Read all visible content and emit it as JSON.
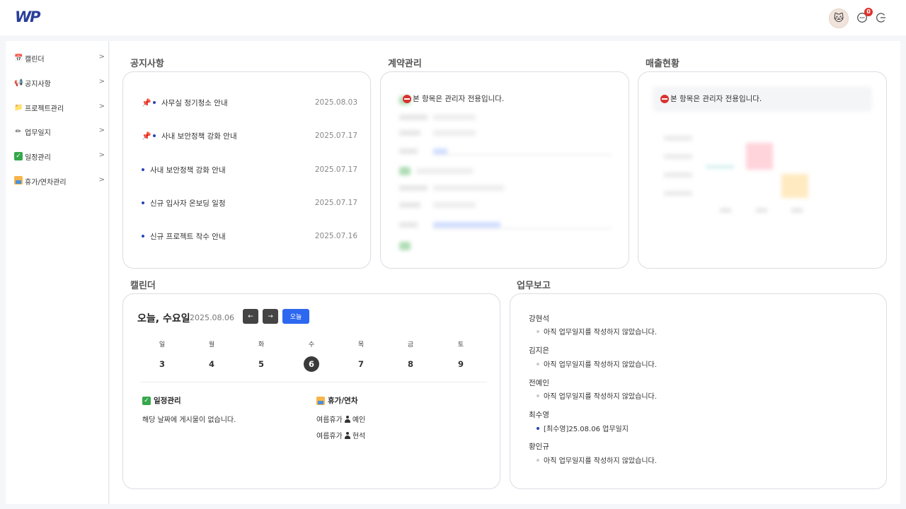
{
  "brand": {
    "logo": "WP"
  },
  "header": {
    "badge_count": "0"
  },
  "sidebar": {
    "items": [
      {
        "label": "캘린더",
        "icon": "calendar-icon"
      },
      {
        "label": "공지사항",
        "icon": "megaphone-icon"
      },
      {
        "label": "프로젝트관리",
        "icon": "folder-icon"
      },
      {
        "label": "업무일지",
        "icon": "pencil-icon"
      },
      {
        "label": "일정관리",
        "icon": "check-icon"
      },
      {
        "label": "휴가/연차관리",
        "icon": "vacation-icon"
      }
    ]
  },
  "notice": {
    "title": "공지사항",
    "items": [
      {
        "title": "사무실 정기청소 안내",
        "date": "2025.08.03",
        "pinned": true
      },
      {
        "title": "사내 보안정책 강화 안내",
        "date": "2025.07.17",
        "pinned": true
      },
      {
        "title": "사내 보안정책 강화 안내",
        "date": "2025.07.17",
        "pinned": false
      },
      {
        "title": "신규 입사자 온보딩 일정",
        "date": "2025.07.17",
        "pinned": false
      },
      {
        "title": "신규 프로젝트 착수 안내",
        "date": "2025.07.16",
        "pinned": false
      }
    ]
  },
  "contract": {
    "title": "계약관리",
    "admin_msg": "본 항목은 관리자 전용입니다."
  },
  "sales": {
    "title": "매출현황",
    "admin_msg": "본 항목은 관리자 전용입니다."
  },
  "calendar": {
    "title": "캘린더",
    "today_label": "오늘, 수요일",
    "date": "2025.08.06",
    "prev": "←",
    "next": "→",
    "today_button": "오늘",
    "weekdays": [
      "일",
      "월",
      "화",
      "수",
      "목",
      "금",
      "토"
    ],
    "days": [
      "3",
      "4",
      "5",
      "6",
      "7",
      "8",
      "9"
    ],
    "selected_index": 3,
    "schedule": {
      "title": "일정관리",
      "empty": "해당 날짜에 게시물이 없습니다."
    },
    "vacation": {
      "title": "휴가/연차",
      "items": [
        {
          "type": "여름휴가",
          "name": "예인"
        },
        {
          "type": "여름휴가",
          "name": "현석"
        }
      ]
    }
  },
  "report": {
    "title": "업무보고",
    "entries": [
      {
        "name": "강현석",
        "text": "아직 업무일지를 작성하지 않았습니다.",
        "written": false
      },
      {
        "name": "김지은",
        "text": "아직 업무일지를 작성하지 않았습니다.",
        "written": false
      },
      {
        "name": "전예인",
        "text": "아직 업무일지를 작성하지 않았습니다.",
        "written": false
      },
      {
        "name": "최수영",
        "text": "[최수영]25.08.06 업무일지",
        "written": true
      },
      {
        "name": "황인규",
        "text": "아직 업무일지를 작성하지 않았습니다.",
        "written": false
      }
    ]
  },
  "colors": {
    "brand": "#2a3f99",
    "accent": "#2d68f0",
    "badge": "#e0312c"
  }
}
